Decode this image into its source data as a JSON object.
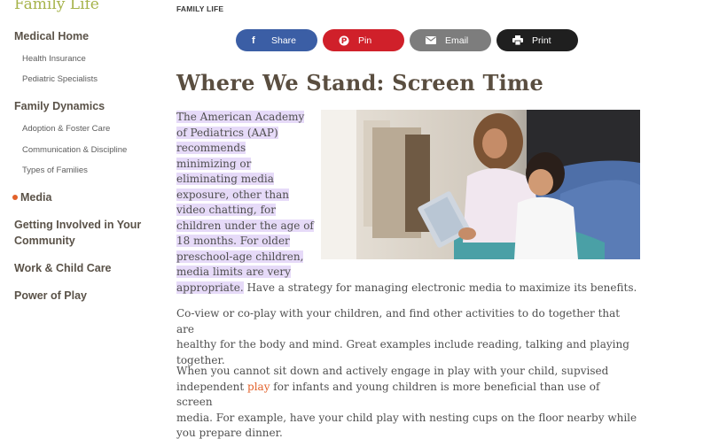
{
  "sidebar": {
    "brand": "Family Life",
    "sections": {
      "medical_home": "Medical Home",
      "health_insurance": "Health Insurance",
      "pediatric_specialists": "Pediatric Specialists",
      "family_dynamics": "Family Dynamics",
      "adoption": "Adoption & Foster Care",
      "communication": "Communication & Discipline",
      "types_of_families": "Types of Families",
      "media": "Media",
      "getting_involved": "Getting Involved in Your Community",
      "work_child_care": "Work & Child Care",
      "power_of_play": "Power of Play"
    }
  },
  "header": {
    "eyebrow": "FAMILY LIFE",
    "share": {
      "share_label": "Share",
      "pin_label": "Pin",
      "email_label": "Email",
      "print_label": "Print"
    },
    "title": "Where We Stand: Screen Time"
  },
  "article": {
    "intro_lines": [
      "The American Academy",
      "of Pediatrics (AAP)",
      "recommends",
      "minimizing or",
      "eliminating media",
      "exposure, other than",
      "video chatting, for",
      "children under the age of",
      "18 months. For older",
      "preschool-age children,",
      "media limits are very"
    ],
    "intro_last_highlighted": "appropriate.",
    "intro_last_rest": " Have a strategy for managing electronic media to maximize its benefits.",
    "p2_lines": [
      "Co-view or co-play with your children, and find other activities to do together that are",
      "healthy for the body and mind. Great examples include reading, talking and playing",
      "together."
    ],
    "p3_line1": "When you cannot sit down and actively engage in play with your child, supvised",
    "p3_line2_a": "independent ",
    "p3_line2_link": "play",
    "p3_line2_b": " for infants and young children is more beneficial than use of screen",
    "p3_line3": "media. For example, have your child play with nesting cups on the floor nearby while",
    "p3_line4": "you prepare dinner."
  },
  "colors": {
    "accent": "#e2612a",
    "brand": "#a6b34a",
    "highlight": "#e6daf8",
    "share": "#3b5ea5",
    "pin": "#d0202a",
    "email": "#7d7d7d",
    "print": "#1f1f1f"
  },
  "icons": [
    "facebook-icon",
    "pinterest-icon",
    "email-icon",
    "print-icon"
  ]
}
